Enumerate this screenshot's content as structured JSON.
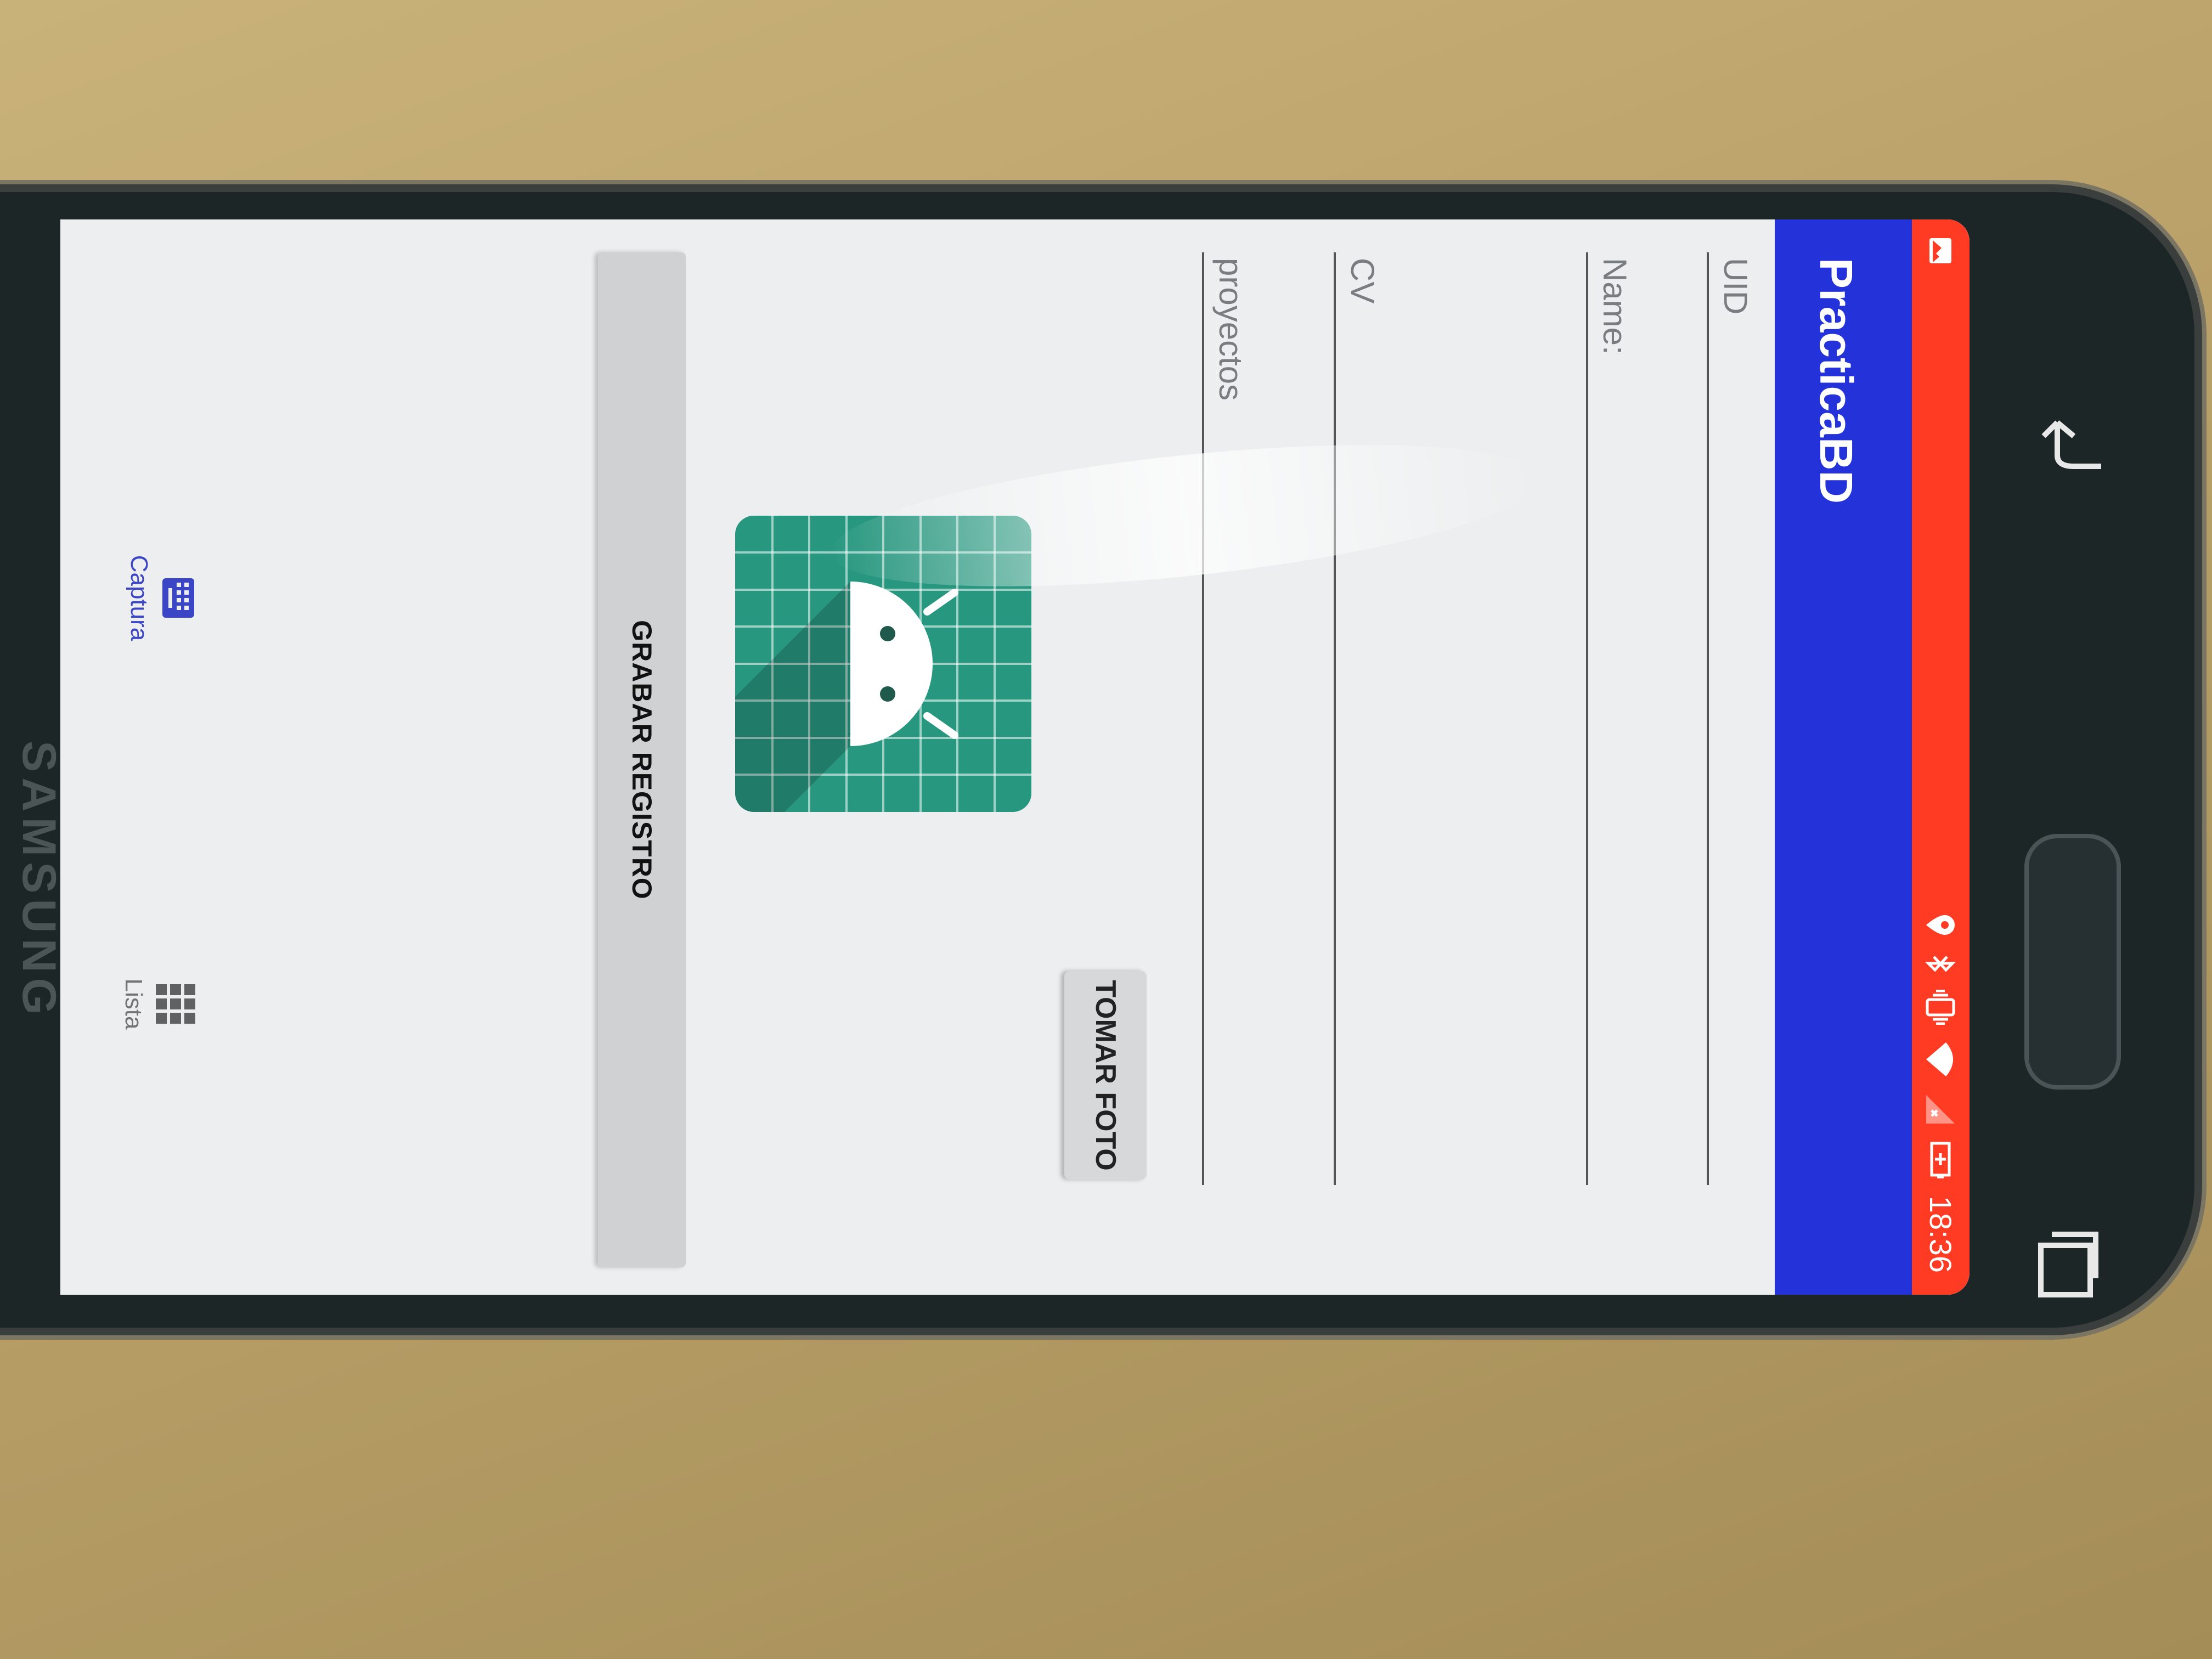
{
  "device": {
    "brand": "SAMSUNG"
  },
  "status_bar": {
    "time": "18:36"
  },
  "app_bar": {
    "title": "PracticaBD"
  },
  "form": {
    "uid_hint": "UID",
    "name_hint": "Name:",
    "cv_hint": "CV",
    "proyectos_hint": "proyectos"
  },
  "buttons": {
    "tomar_foto": "TOMAR FOTO",
    "grabar_registro": "GRABAR REGISTRO"
  },
  "image": {
    "icon": "android-robot-icon"
  },
  "bottom_nav": {
    "items": [
      {
        "label": "Captura",
        "icon": "keyboard-icon",
        "active": true
      },
      {
        "label": "Lista",
        "icon": "grid-icon",
        "active": false
      }
    ]
  },
  "colors": {
    "status_bar": "#ff3b24",
    "app_bar": "#2432d9",
    "image_bg": "#28977f",
    "nav_active": "#3b46c7"
  }
}
